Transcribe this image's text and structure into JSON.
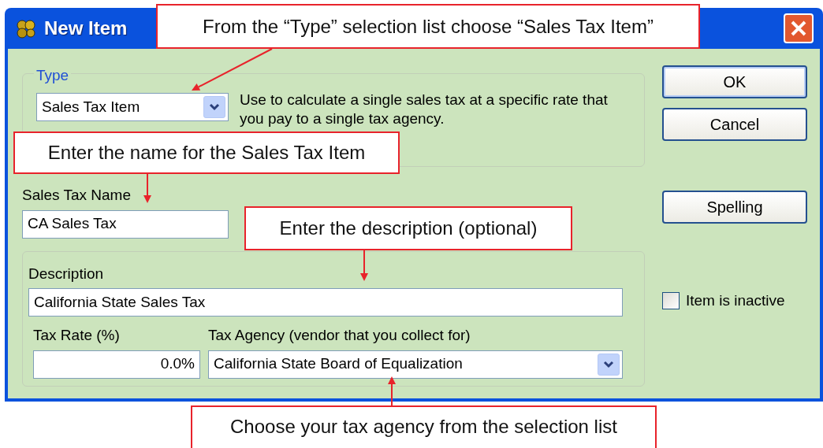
{
  "window": {
    "title": "New Item"
  },
  "type_group": {
    "label": "Type",
    "value": "Sales Tax Item",
    "description": "Use to calculate a single sales tax at a specific rate that you pay to a single tax agency."
  },
  "sales_tax_name": {
    "label": "Sales Tax Name",
    "value": "CA Sales Tax"
  },
  "description": {
    "label": "Description",
    "value": "California State Sales Tax"
  },
  "tax_rate": {
    "label": "Tax Rate (%)",
    "value": "0.0%"
  },
  "tax_agency": {
    "label": "Tax Agency (vendor that you collect for)",
    "value": "California State Board of Equalization"
  },
  "buttons": [
    "OK",
    "Cancel",
    "Spelling"
  ],
  "item_inactive": {
    "label": "Item is inactive",
    "checked": false
  },
  "callouts": [
    {
      "text": "From the “Type” selection list choose “Sales Tax Item”"
    },
    {
      "text": "Enter the name for the Sales Tax Item"
    },
    {
      "text": "Enter the description (optional)"
    },
    {
      "text": "Choose your tax agency from the selection list"
    }
  ]
}
